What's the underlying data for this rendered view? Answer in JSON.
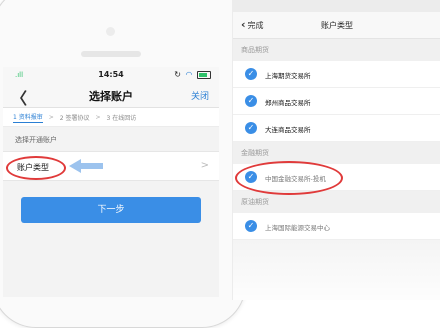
{
  "left_phone": {
    "status_bar": {
      "signal": ".ıll",
      "time": "14:54",
      "right_icons": [
        "refresh-icon",
        "wifi-icon",
        "battery-icon"
      ]
    },
    "nav": {
      "back_glyph": "〈",
      "title": "选择账户",
      "close_label": "关闭"
    },
    "steps": [
      {
        "label": "1 资料报审",
        "active": true
      },
      {
        "label": "2 签署协议",
        "active": false
      },
      {
        "label": "3 在线回访",
        "active": false
      }
    ],
    "step_arrow": ">",
    "section_label": "选择开通账户",
    "row": {
      "label": "账户类型",
      "chevron": ">"
    },
    "primary_button_label": "下一步"
  },
  "right_screen": {
    "nav": {
      "back_label": "完成",
      "title": "账户类型"
    },
    "groups": [
      {
        "header": "商品期货",
        "items": [
          "上海期货交易所",
          "郑州商品交易所",
          "大连商品交易所"
        ]
      },
      {
        "header": "金融期货",
        "items": [
          "中国金融交易所-投机"
        ]
      },
      {
        "header": "原油期货",
        "items": [
          "上海国际能源交易中心"
        ]
      }
    ],
    "check_glyph": "✓"
  },
  "colors": {
    "accent": "#3a8ee6",
    "highlight": "#e03a3a",
    "pointer": "#9cc3ee"
  }
}
